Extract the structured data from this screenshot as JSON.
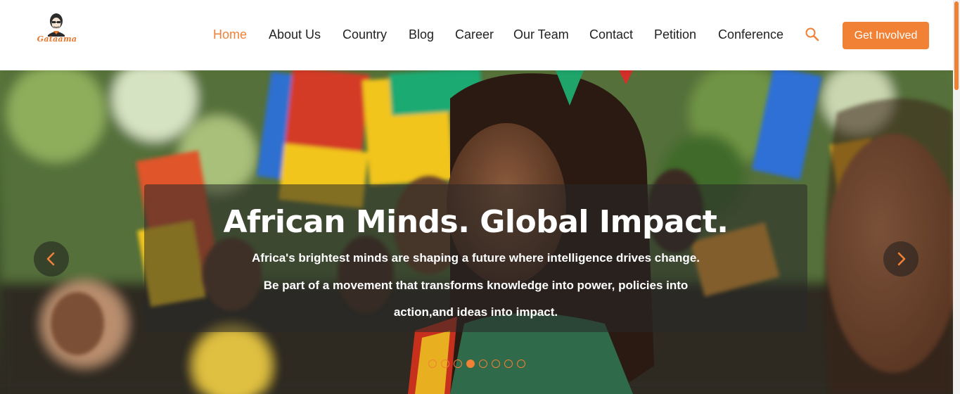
{
  "brand": {
    "name": "Gataama",
    "accent_color": "#f08135"
  },
  "nav": {
    "items": [
      {
        "label": "Home",
        "active": true
      },
      {
        "label": "About Us",
        "active": false
      },
      {
        "label": "Country",
        "active": false
      },
      {
        "label": "Blog",
        "active": false
      },
      {
        "label": "Career",
        "active": false
      },
      {
        "label": "Our Team",
        "active": false
      },
      {
        "label": "Contact",
        "active": false
      },
      {
        "label": "Petition",
        "active": false
      },
      {
        "label": "Conference",
        "active": false
      }
    ],
    "search_icon": "search-icon",
    "cta_label": "Get Involved"
  },
  "hero": {
    "title": "African Minds. Global Impact.",
    "subtitle_lines": [
      "Africa's brightest minds are shaping a future where intelligence drives change.",
      "Be part of a movement that transforms knowledge into power, policies into",
      "action,and ideas into impact."
    ],
    "prev_icon": "chevron-left-icon",
    "next_icon": "chevron-right-icon",
    "slide_count": 8,
    "active_slide": 4
  }
}
